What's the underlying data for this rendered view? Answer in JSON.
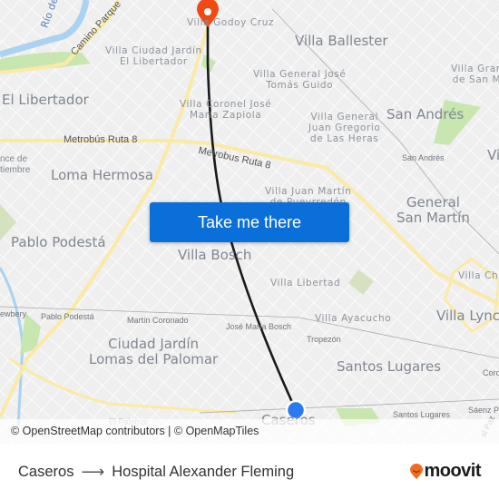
{
  "map": {
    "colors": {
      "background": "#efefef",
      "street": "#ffffff",
      "highway": "#fbeaa6",
      "park": "#c8e6b0",
      "water": "#a9d3f0",
      "route": "#1a1a1a",
      "origin_marker": "#2a7af0",
      "destination_marker": "#f04a14"
    },
    "labels": {
      "rio": "Río de",
      "camino_parque": "Camino Parque",
      "villa_godoy_cruz": "Villa Godoy Cruz",
      "villa_ballester": "Villa Ballester",
      "villa_ciudad_jardin": "Villa Ciudad Jardín\nEl Libertador",
      "el_libertador": "El Libertador",
      "villa_general_jose": "Villa General José\nTomás Guido",
      "villa_gran": "Villa Gran\nde San M",
      "villa_coronel": "Villa Coronel José\nMaría Zapiola",
      "villa_general_juan": "Villa General\nJuan Gregorio\nde Las Heras",
      "san_andres": "San Andrés",
      "san_andres_station": "San Andrés",
      "vi": "Vi",
      "metrobus_1": "Metrobús Ruta 8",
      "metrobus_2": "Metrobus Ruta 8",
      "ance_de_tiembre": "nce de\ntiembre",
      "loma_hermosa": "Loma Hermosa",
      "villa_juan_martin": "Villa Juan Martín\nde Pueyrredón",
      "general_san_martin": "General\nSan Martín",
      "pablo_podesta": "Pablo Podestá",
      "villa_bosch": "Villa Bosch",
      "villa_libertad": "Villa Libertad",
      "villa_cha": "Villa Cha",
      "newbery": "ewbery",
      "pablo_podesta_station": "Pablo Podestá",
      "martin_coronado": "Martín Coronado",
      "jose_maria_bosch": "José María Bosch",
      "villa_ayacucho": "Villa Ayacucho",
      "villa_lynch": "Villa Lynch",
      "tropezon": "Tropezón",
      "ciudad_jardin": "Ciudad Jardín\nLomas del Palomar",
      "santos_lugares": "Santos Lugares",
      "coro": "Coro",
      "el_palomar": "El Palomar",
      "caseros": "Caseros",
      "santos_lugares_station": "Santos Lugares",
      "saenz_pena": "Sáenz Pe",
      "al_paz": "al Paz"
    },
    "cta_label": "Take me there",
    "attribution": "© OpenStreetMap contributors | © OpenMapTiles"
  },
  "footer": {
    "origin": "Caseros",
    "arrow": "⟶",
    "destination": "Hospital Alexander Fleming",
    "brand": "moovit"
  }
}
